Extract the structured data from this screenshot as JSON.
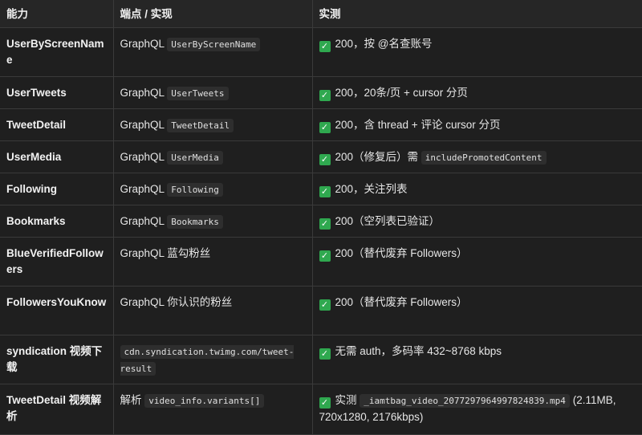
{
  "headers": [
    "能力",
    "端点 / 实现",
    "实测"
  ],
  "icons": {
    "status": "check-icon",
    "status_color": "#2fa84f"
  },
  "rows": [
    {
      "cap": "UserByScreenName",
      "impl_prefix": "GraphQL",
      "impl_code": "UserByScreenName",
      "impl_suffix": "",
      "result_text": "200，按 @名查账号",
      "result_code": "",
      "result_after": ""
    },
    {
      "cap": "UserTweets",
      "impl_prefix": "GraphQL",
      "impl_code": "UserTweets",
      "impl_suffix": "",
      "result_text": "200，20条/页 + cursor 分页",
      "result_code": "",
      "result_after": ""
    },
    {
      "cap": "TweetDetail",
      "impl_prefix": "GraphQL",
      "impl_code": "TweetDetail",
      "impl_suffix": "",
      "result_text": "200，含 thread + 评论 cursor 分页",
      "result_code": "",
      "result_after": ""
    },
    {
      "cap": "UserMedia",
      "impl_prefix": "GraphQL",
      "impl_code": "UserMedia",
      "impl_suffix": "",
      "result_text": "200（修复后）需",
      "result_code": "includePromotedContent",
      "result_after": ""
    },
    {
      "cap": "Following",
      "impl_prefix": "GraphQL",
      "impl_code": "Following",
      "impl_suffix": "",
      "result_text": "200，关注列表",
      "result_code": "",
      "result_after": ""
    },
    {
      "cap": "Bookmarks",
      "impl_prefix": "GraphQL",
      "impl_code": "Bookmarks",
      "impl_suffix": "",
      "result_text": "200（空列表已验证）",
      "result_code": "",
      "result_after": ""
    },
    {
      "cap": "BlueVerifiedFollowers",
      "impl_prefix": "GraphQL 蓝勾粉丝",
      "impl_code": "",
      "impl_suffix": "",
      "result_text": "200（替代废弃 Followers）",
      "result_code": "",
      "result_after": ""
    },
    {
      "cap": "FollowersYouKnow",
      "impl_prefix": "GraphQL 你认识的粉丝",
      "impl_code": "",
      "impl_suffix": "",
      "result_text": "200（替代废弃 Followers）",
      "result_code": "",
      "result_after": ""
    },
    {
      "cap": "syndication 视频下载",
      "impl_prefix": "",
      "impl_code": "cdn.syndication.twimg.com/tweet-result",
      "impl_suffix": "",
      "result_text": "无需 auth，多码率 432~8768 kbps",
      "result_code": "",
      "result_after": ""
    },
    {
      "cap": "TweetDetail 视频解析",
      "impl_prefix": "解析",
      "impl_code": "video_info.variants[]",
      "impl_suffix": "",
      "result_text": "实测",
      "result_code": "_iamtbag_video_2077297964997824839.mp4",
      "result_after": "(2.11MB, 720x1280, 2176kbps)"
    }
  ]
}
